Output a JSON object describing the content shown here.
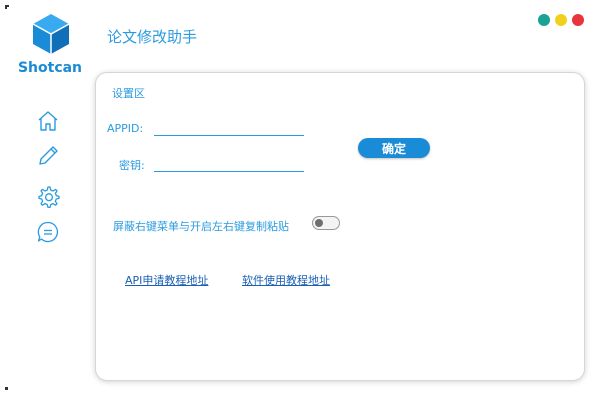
{
  "brand": {
    "name": "Shotcan"
  },
  "app": {
    "title": "论文修改助手"
  },
  "colors": {
    "accent": "#2a9be0",
    "button": "#1a8bd6",
    "dot_green": "#1aa394",
    "dot_yellow": "#f0d21e",
    "dot_red": "#e8343c"
  },
  "sidebar": {
    "icons": [
      "home-icon",
      "pencil-icon",
      "gear-icon",
      "chat-icon"
    ]
  },
  "panel": {
    "section_label": "设置区",
    "appid_label": "APPID:",
    "appid_value": "",
    "key_label": "密钥:",
    "key_value": "",
    "confirm_label": "确定",
    "toggle_label": "屏蔽右键菜单与开启左右键复制粘贴",
    "toggle_on": false,
    "link_api": "API申请教程地址",
    "link_usage": "软件使用教程地址"
  }
}
